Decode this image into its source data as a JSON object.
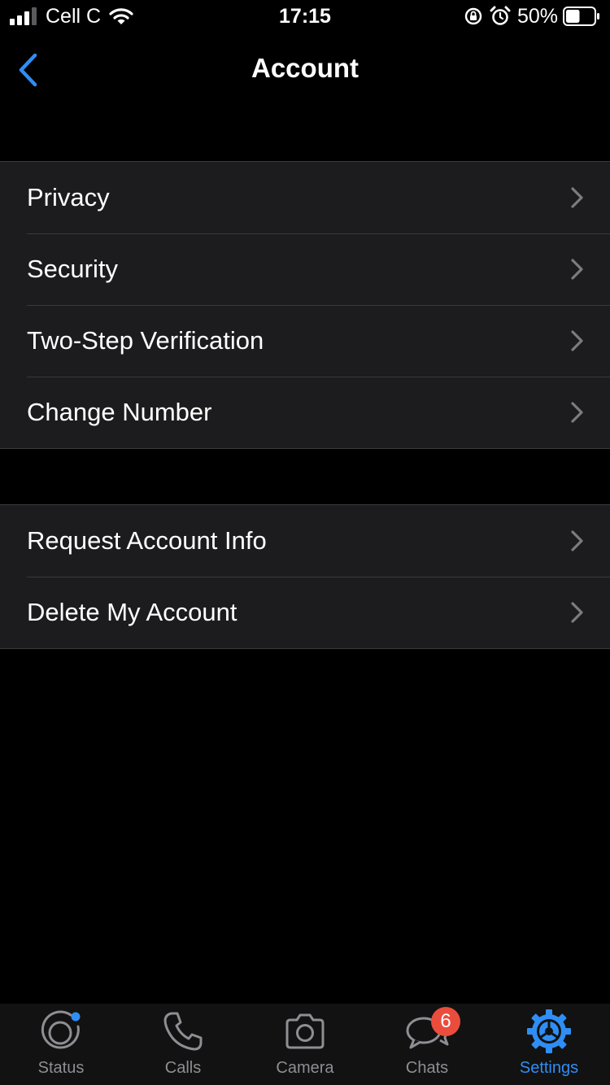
{
  "status_bar": {
    "carrier": "Cell C",
    "time": "17:15",
    "battery_percent": "50%",
    "battery_level": 0.5
  },
  "nav": {
    "title": "Account",
    "back_icon": "chevron-left-icon",
    "accent_color": "#2f8ef4"
  },
  "groups": [
    {
      "items": [
        {
          "label": "Privacy"
        },
        {
          "label": "Security"
        },
        {
          "label": "Two-Step Verification"
        },
        {
          "label": "Change Number"
        }
      ]
    },
    {
      "items": [
        {
          "label": "Request Account Info"
        },
        {
          "label": "Delete My Account"
        }
      ]
    }
  ],
  "tab_bar": {
    "tabs": [
      {
        "label": "Status",
        "icon": "status-icon"
      },
      {
        "label": "Calls",
        "icon": "phone-icon"
      },
      {
        "label": "Camera",
        "icon": "camera-icon"
      },
      {
        "label": "Chats",
        "icon": "chats-icon",
        "badge": "6"
      },
      {
        "label": "Settings",
        "icon": "gear-icon",
        "active": true
      }
    ]
  }
}
